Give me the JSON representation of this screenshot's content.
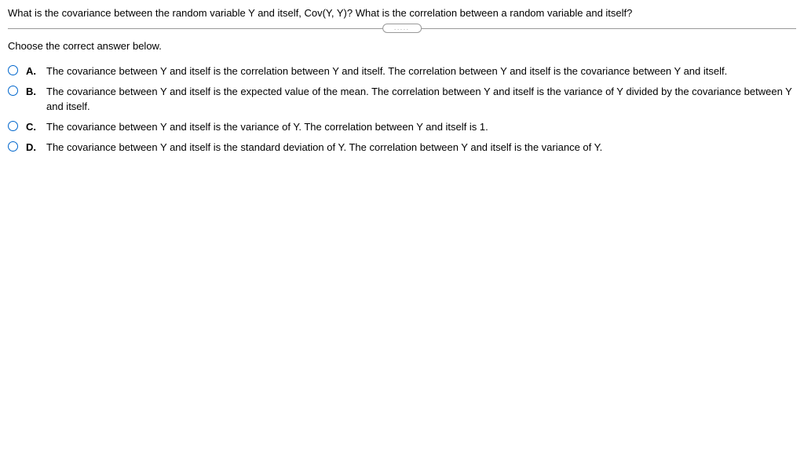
{
  "question": "What is the covariance between the random variable Y and itself, Cov(Y, Y)? What is the correlation between a random variable and itself?",
  "divider_dots": ".....",
  "instruction": "Choose the correct answer below.",
  "options": [
    {
      "letter": "A.",
      "text": "The covariance between Y and itself is the correlation between Y and itself. The correlation between Y and itself is the covariance between Y and itself."
    },
    {
      "letter": "B.",
      "text": "The covariance between Y and itself is the expected value of the mean. The correlation between Y and itself is the variance of Y divided by the covariance between Y and itself."
    },
    {
      "letter": "C.",
      "text": "The covariance between Y and itself is the variance of Y. The correlation between Y and itself is 1."
    },
    {
      "letter": "D.",
      "text": "The covariance between Y and itself is the standard deviation of Y. The correlation between Y and itself is the variance of Y."
    }
  ]
}
